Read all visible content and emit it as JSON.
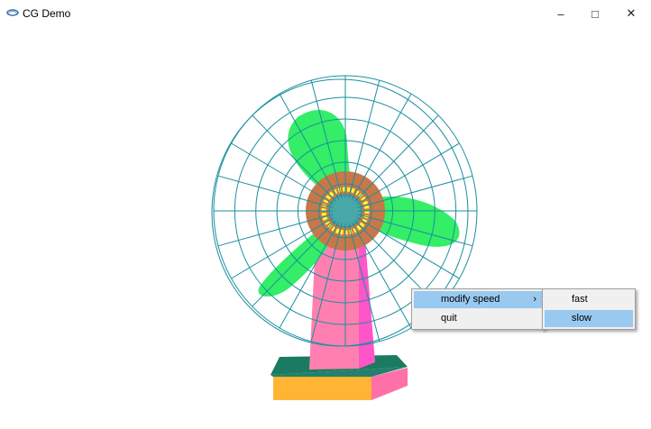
{
  "window": {
    "title": "CG Demo",
    "controls": {
      "minimize": "–",
      "maximize": "□",
      "close": "✕"
    },
    "app_icon": "app-icon"
  },
  "context_menu": {
    "items": [
      {
        "label": "modify speed",
        "has_submenu": true,
        "highlighted": true
      },
      {
        "label": "quit",
        "has_submenu": false,
        "highlighted": false
      }
    ],
    "submenu_arrow": "›"
  },
  "submenu": {
    "items": [
      {
        "label": "fast",
        "highlighted": false
      },
      {
        "label": "slow",
        "highlighted": true
      }
    ]
  },
  "scene": {
    "colors": {
      "cage": "#1a8fa0",
      "blades": "#33ee66",
      "blade_lines": "#1a6b50",
      "hub": "#c87848",
      "hub_ring": "#ffff33",
      "stand": "#ff80b0",
      "stand_shade": "#ff55c8",
      "base_top": "#1b7a62",
      "base_front": "#ffb533",
      "base_side": "#ff6fa8",
      "menu_highlight": "#99c9ef"
    }
  }
}
